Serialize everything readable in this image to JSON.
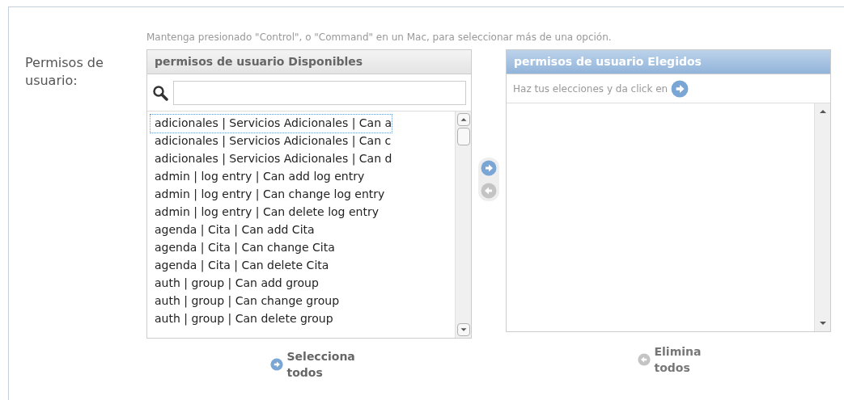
{
  "field_label": "Permisos de usuario:",
  "help_text": "Mantenga presionado \"Control\", o \"Command\" en un Mac, para seleccionar más de una opción.",
  "available": {
    "title": "permisos de usuario Disponibles",
    "items": [
      {
        "label": "adicionales | Servicios Adicionales | Can a",
        "focused": true
      },
      {
        "label": "adicionales | Servicios Adicionales | Can c",
        "focused": false
      },
      {
        "label": "adicionales | Servicios Adicionales | Can d",
        "focused": false
      },
      {
        "label": "admin | log entry | Can add log entry",
        "focused": false
      },
      {
        "label": "admin | log entry | Can change log entry",
        "focused": false
      },
      {
        "label": "admin | log entry | Can delete log entry",
        "focused": false
      },
      {
        "label": "agenda | Cita | Can add Cita",
        "focused": false
      },
      {
        "label": "agenda | Cita | Can change Cita",
        "focused": false
      },
      {
        "label": "agenda | Cita | Can delete Cita",
        "focused": false
      },
      {
        "label": "auth | group | Can add group",
        "focused": false
      },
      {
        "label": "auth | group | Can change group",
        "focused": false
      },
      {
        "label": "auth | group | Can delete group",
        "focused": false
      }
    ],
    "all_link": {
      "label": "Selecciona todos",
      "enabled": true
    }
  },
  "move_buttons": {
    "add_enabled": true,
    "remove_enabled": false
  },
  "chosen": {
    "title": "permisos de usuario Elegidos",
    "help": "Haz tus elecciones y da click en",
    "all_link": {
      "label": "Elimina todos",
      "enabled": false
    }
  }
}
